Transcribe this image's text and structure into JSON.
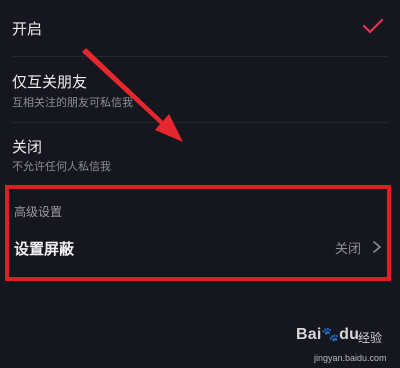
{
  "options": [
    {
      "title": "开启",
      "subtitle": ""
    },
    {
      "title": "仅互关朋友",
      "subtitle": "互相关注的朋友可私信我"
    },
    {
      "title": "关闭",
      "subtitle": "不允许任何人私信我"
    }
  ],
  "advanced": {
    "section_label": "高级设置",
    "item_title": "设置屏蔽",
    "item_value": "关闭"
  },
  "watermark": {
    "logo": "Bai",
    "logo_suffix": "du",
    "brand_cn": "经验",
    "url": "jingyan.baidu.com"
  },
  "colors": {
    "accent_check": "#e8334f",
    "highlight_border": "#e21d24",
    "background": "#16171e"
  },
  "icons": {
    "selected": "checkmark-icon",
    "chevron": "chevron-right-icon",
    "annotation": "red-arrow-annotation"
  }
}
